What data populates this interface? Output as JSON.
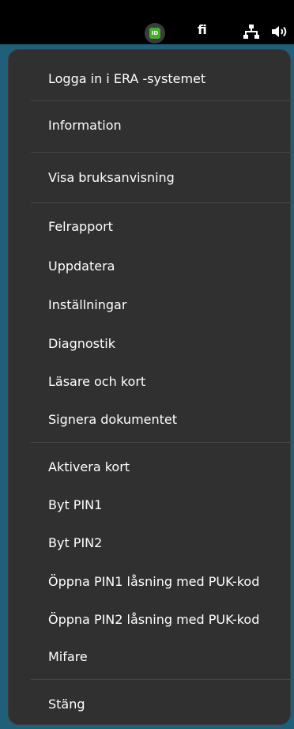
{
  "topbar": {
    "tray_id_badge": "ID",
    "language": "fi",
    "network_icon": "network-icon",
    "volume_icon": "volume-icon",
    "tray_id_color": "#43b02a"
  },
  "menu": {
    "items": [
      "Logga in i ERA -systemet",
      "Information",
      "Visa bruksanvisning",
      "Felrapport",
      "Uppdatera",
      "Inställningar",
      "Diagnostik",
      "Läsare och kort",
      "Signera dokumentet",
      "Aktivera kort",
      "Byt PIN1",
      "Byt PIN2",
      "Öppna PIN1 låsning med PUK-kod",
      "Öppna PIN2 låsning med PUK-kod",
      "Mifare",
      "Stäng"
    ]
  }
}
